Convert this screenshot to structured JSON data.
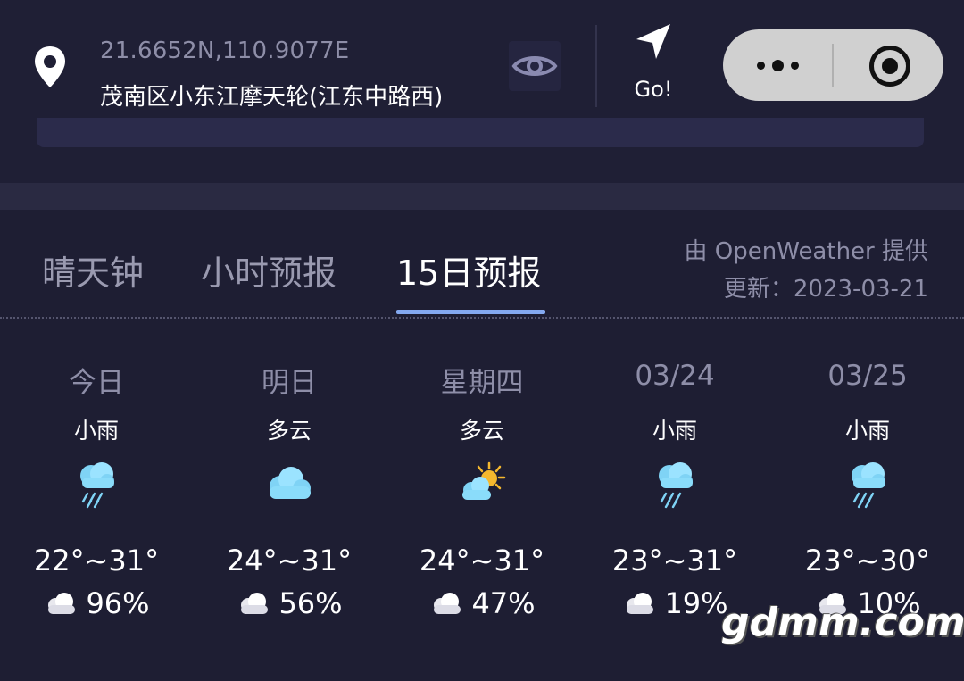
{
  "location": {
    "coords": "21.6652N,110.9077E",
    "address": "茂南区小东江摩天轮(江东中路西)",
    "pin_icon": "location-pin-icon",
    "eye_icon": "eye-icon",
    "go_label": "Go!",
    "go_icon": "navigation-arrow-icon"
  },
  "capsule": {
    "more_icon": "more-dots-icon",
    "close_icon": "target-circle-icon",
    "color": "#d0d0d0"
  },
  "tabs": [
    {
      "label": "晴天钟",
      "active": false
    },
    {
      "label": "小时预报",
      "active": false
    },
    {
      "label": "15日预报",
      "active": true
    }
  ],
  "provider": "由 OpenWeather 提供",
  "updated": "更新：2023-03-21",
  "accent_color": "#84a9f0",
  "forecast": [
    {
      "day": "今日",
      "condition": "小雨",
      "icon": "light-rain-icon",
      "temp": "22°~31°",
      "precip": "96%"
    },
    {
      "day": "明日",
      "condition": "多云",
      "icon": "cloud-icon",
      "temp": "24°~31°",
      "precip": "56%"
    },
    {
      "day": "星期四",
      "condition": "多云",
      "icon": "partly-cloudy-icon",
      "temp": "24°~31°",
      "precip": "47%"
    },
    {
      "day": "03/24",
      "condition": "小雨",
      "icon": "light-rain-icon",
      "temp": "23°~31°",
      "precip": "19%"
    },
    {
      "day": "03/25",
      "condition": "小雨",
      "icon": "light-rain-icon",
      "temp": "23°~30°",
      "precip": "10%"
    }
  ],
  "watermark": "gdmm.com"
}
